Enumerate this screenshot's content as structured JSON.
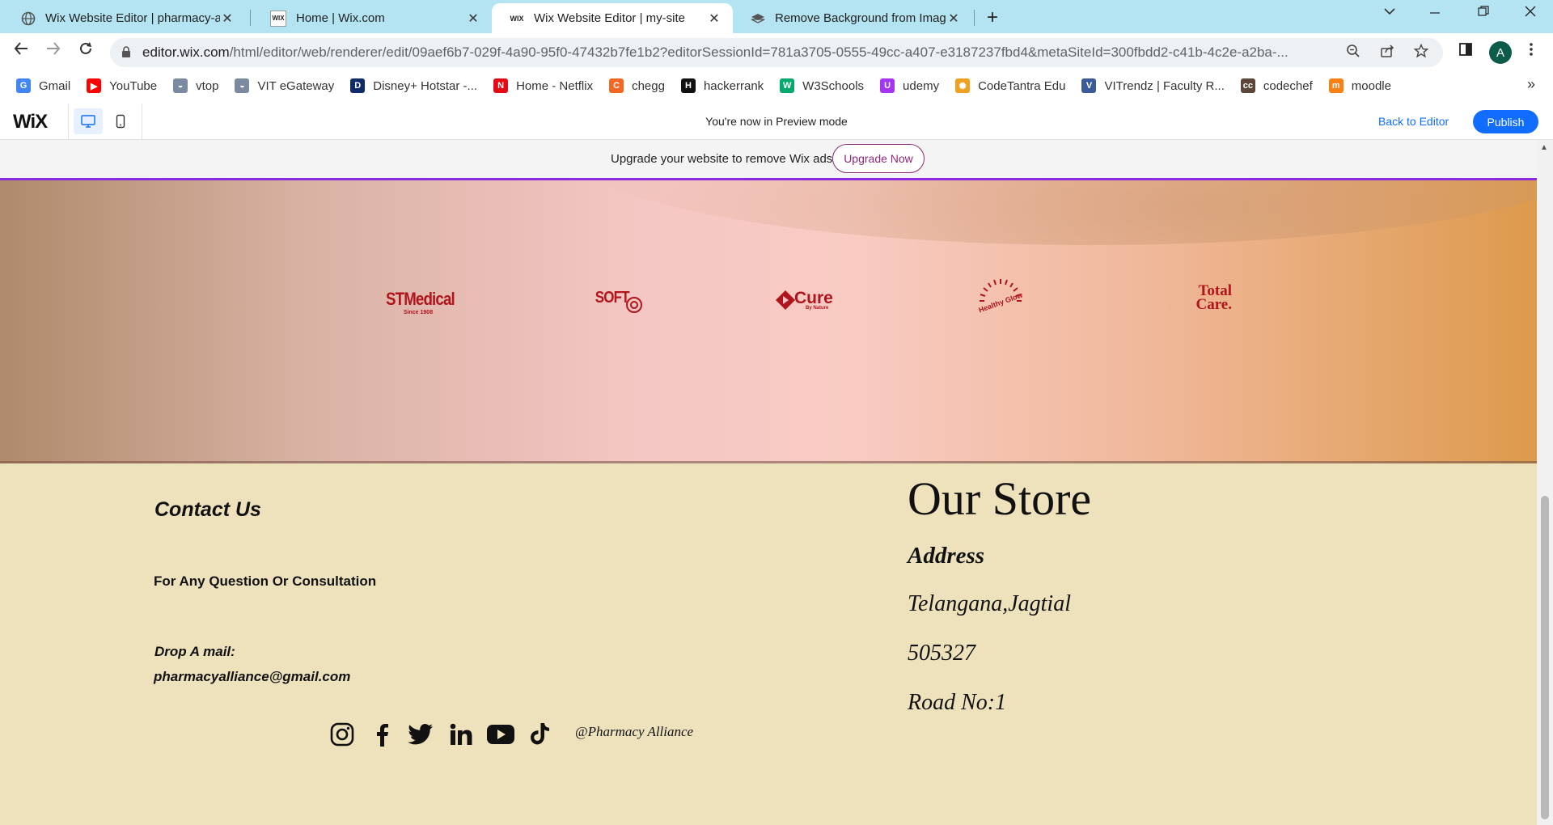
{
  "browser": {
    "tabs": [
      {
        "title": "Wix Website Editor | pharmacy-a",
        "icon": "globe-icon"
      },
      {
        "title": "Home | Wix.com",
        "icon": "wix-icon"
      },
      {
        "title": "Wix Website Editor | my-site",
        "icon": "wix-icon"
      },
      {
        "title": "Remove Background from Image",
        "icon": "removebg-icon"
      }
    ],
    "url_host": "editor.wix.com",
    "url_rest": "/html/editor/web/renderer/edit/09aef6b7-029f-4a90-95f0-47432b7fe1b2?editorSessionId=781a3705-0555-49cc-a407-e3187237fbd4&metaSiteId=300fbdd2-c41b-4c2e-a2ba-...",
    "avatar_letter": "A",
    "bookmarks": [
      {
        "label": "Gmail",
        "icon": "G",
        "color": "#4285f4"
      },
      {
        "label": "YouTube",
        "icon": "▶",
        "color": "#ff0000"
      },
      {
        "label": "vtop",
        "icon": "◒",
        "color": "#7a8aa0"
      },
      {
        "label": "VIT eGateway",
        "icon": "◒",
        "color": "#7a8aa0"
      },
      {
        "label": "Disney+ Hotstar -...",
        "icon": "D",
        "color": "#0f2b6b"
      },
      {
        "label": "Home - Netflix",
        "icon": "N",
        "color": "#e50914"
      },
      {
        "label": "chegg",
        "icon": "C",
        "color": "#f26722"
      },
      {
        "label": "hackerrank",
        "icon": "H",
        "color": "#111111"
      },
      {
        "label": "W3Schools",
        "icon": "W",
        "color": "#04aa6d"
      },
      {
        "label": "udemy",
        "icon": "U",
        "color": "#a435f0"
      },
      {
        "label": "CodeTantra Edu",
        "icon": "✺",
        "color": "#f0a020"
      },
      {
        "label": "VITrendz | Faculty R...",
        "icon": "V",
        "color": "#3a5a9a"
      },
      {
        "label": "codechef",
        "icon": "cc",
        "color": "#5b4638"
      },
      {
        "label": "moodle",
        "icon": "m",
        "color": "#f98012"
      }
    ]
  },
  "wixbar": {
    "logo": "WiX",
    "preview_msg": "You're now in Preview mode",
    "back_label": "Back to Editor",
    "publish_label": "Publish"
  },
  "upgrade": {
    "message": "Upgrade your website to remove Wix ads",
    "button": "Upgrade Now"
  },
  "partner_logos": [
    {
      "name": "STMedical",
      "sub": "Since 1908"
    },
    {
      "name": "SOFT",
      "sub": ""
    },
    {
      "name": "Cure",
      "sub": "By Nature"
    },
    {
      "name": "Healthy Glow",
      "sub": ""
    },
    {
      "name": "Total Care.",
      "sub": ""
    }
  ],
  "contact": {
    "title": "Contact Us",
    "question": "For Any Question Or Consultation",
    "drop_label": "Drop A mail:",
    "email": "pharmacyalliance@gmail.com"
  },
  "store": {
    "title": "Our Store",
    "address_label": "Address",
    "lines": [
      "Telangana,Jagtial",
      "505327",
      "Road No:1"
    ]
  },
  "social": {
    "icons": [
      "instagram-icon",
      "facebook-icon",
      "twitter-icon",
      "linkedin-icon",
      "youtube-icon",
      "tiktok-icon"
    ],
    "handle": "@Pharmacy Alliance"
  }
}
